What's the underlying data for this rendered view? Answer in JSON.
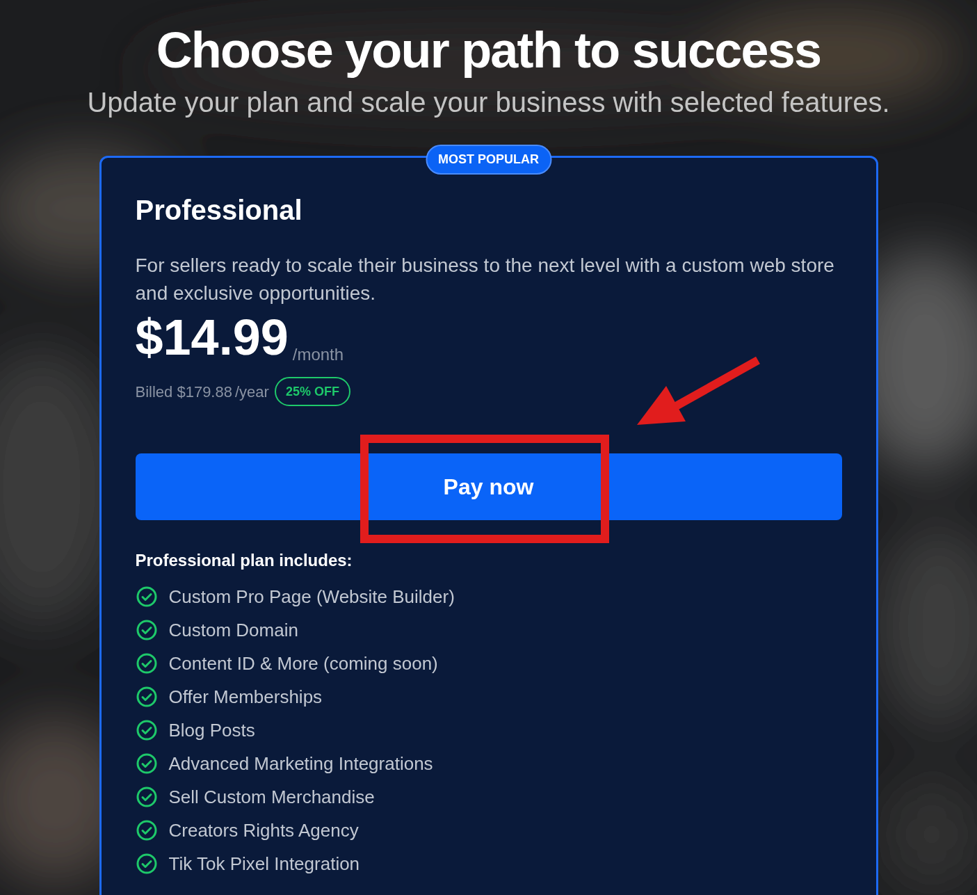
{
  "header": {
    "title": "Choose your path to success",
    "subtitle": "Update your plan and scale your business with selected features."
  },
  "plan": {
    "badge": "MOST POPULAR",
    "name": "Professional",
    "description": "For sellers ready to scale their business to the next level with a custom web store and exclusive opportunities.",
    "price": "$14.99",
    "period": "/month",
    "billed": "Billed $179.88",
    "billed_period": "/year",
    "discount": "25% OFF",
    "button": "Pay now",
    "includes_heading": "Professional plan includes:",
    "features": [
      "Custom Pro Page (Website Builder)",
      "Custom Domain",
      "Content ID & More (coming soon)",
      "Offer Memberships",
      "Blog Posts",
      "Advanced Marketing Integrations",
      "Sell Custom Merchandise",
      "Creators Rights Agency",
      "Tik Tok Pixel Integration"
    ]
  }
}
